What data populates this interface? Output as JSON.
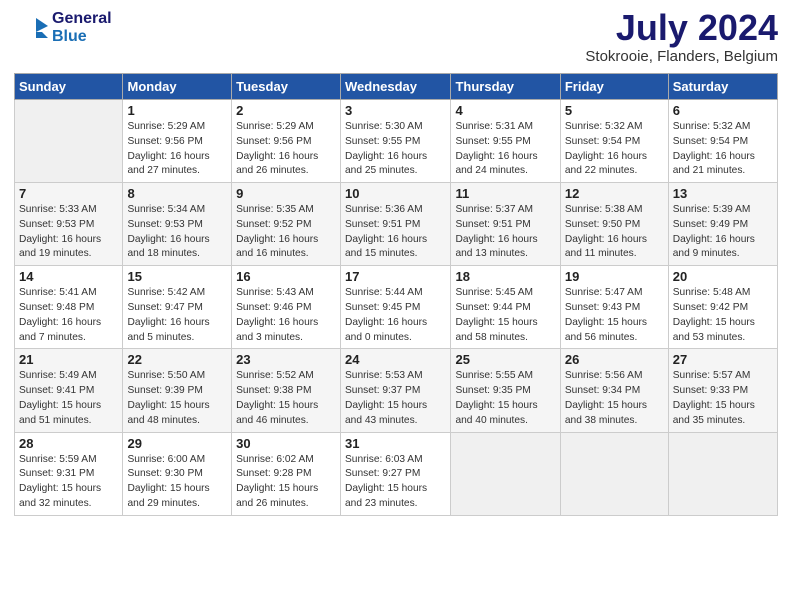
{
  "header": {
    "logo_line1": "General",
    "logo_line2": "Blue",
    "month_title": "July 2024",
    "location": "Stokrooie, Flanders, Belgium"
  },
  "weekdays": [
    "Sunday",
    "Monday",
    "Tuesday",
    "Wednesday",
    "Thursday",
    "Friday",
    "Saturday"
  ],
  "weeks": [
    [
      {
        "day": "",
        "info": ""
      },
      {
        "day": "1",
        "info": "Sunrise: 5:29 AM\nSunset: 9:56 PM\nDaylight: 16 hours\nand 27 minutes."
      },
      {
        "day": "2",
        "info": "Sunrise: 5:29 AM\nSunset: 9:56 PM\nDaylight: 16 hours\nand 26 minutes."
      },
      {
        "day": "3",
        "info": "Sunrise: 5:30 AM\nSunset: 9:55 PM\nDaylight: 16 hours\nand 25 minutes."
      },
      {
        "day": "4",
        "info": "Sunrise: 5:31 AM\nSunset: 9:55 PM\nDaylight: 16 hours\nand 24 minutes."
      },
      {
        "day": "5",
        "info": "Sunrise: 5:32 AM\nSunset: 9:54 PM\nDaylight: 16 hours\nand 22 minutes."
      },
      {
        "day": "6",
        "info": "Sunrise: 5:32 AM\nSunset: 9:54 PM\nDaylight: 16 hours\nand 21 minutes."
      }
    ],
    [
      {
        "day": "7",
        "info": "Sunrise: 5:33 AM\nSunset: 9:53 PM\nDaylight: 16 hours\nand 19 minutes."
      },
      {
        "day": "8",
        "info": "Sunrise: 5:34 AM\nSunset: 9:53 PM\nDaylight: 16 hours\nand 18 minutes."
      },
      {
        "day": "9",
        "info": "Sunrise: 5:35 AM\nSunset: 9:52 PM\nDaylight: 16 hours\nand 16 minutes."
      },
      {
        "day": "10",
        "info": "Sunrise: 5:36 AM\nSunset: 9:51 PM\nDaylight: 16 hours\nand 15 minutes."
      },
      {
        "day": "11",
        "info": "Sunrise: 5:37 AM\nSunset: 9:51 PM\nDaylight: 16 hours\nand 13 minutes."
      },
      {
        "day": "12",
        "info": "Sunrise: 5:38 AM\nSunset: 9:50 PM\nDaylight: 16 hours\nand 11 minutes."
      },
      {
        "day": "13",
        "info": "Sunrise: 5:39 AM\nSunset: 9:49 PM\nDaylight: 16 hours\nand 9 minutes."
      }
    ],
    [
      {
        "day": "14",
        "info": "Sunrise: 5:41 AM\nSunset: 9:48 PM\nDaylight: 16 hours\nand 7 minutes."
      },
      {
        "day": "15",
        "info": "Sunrise: 5:42 AM\nSunset: 9:47 PM\nDaylight: 16 hours\nand 5 minutes."
      },
      {
        "day": "16",
        "info": "Sunrise: 5:43 AM\nSunset: 9:46 PM\nDaylight: 16 hours\nand 3 minutes."
      },
      {
        "day": "17",
        "info": "Sunrise: 5:44 AM\nSunset: 9:45 PM\nDaylight: 16 hours\nand 0 minutes."
      },
      {
        "day": "18",
        "info": "Sunrise: 5:45 AM\nSunset: 9:44 PM\nDaylight: 15 hours\nand 58 minutes."
      },
      {
        "day": "19",
        "info": "Sunrise: 5:47 AM\nSunset: 9:43 PM\nDaylight: 15 hours\nand 56 minutes."
      },
      {
        "day": "20",
        "info": "Sunrise: 5:48 AM\nSunset: 9:42 PM\nDaylight: 15 hours\nand 53 minutes."
      }
    ],
    [
      {
        "day": "21",
        "info": "Sunrise: 5:49 AM\nSunset: 9:41 PM\nDaylight: 15 hours\nand 51 minutes."
      },
      {
        "day": "22",
        "info": "Sunrise: 5:50 AM\nSunset: 9:39 PM\nDaylight: 15 hours\nand 48 minutes."
      },
      {
        "day": "23",
        "info": "Sunrise: 5:52 AM\nSunset: 9:38 PM\nDaylight: 15 hours\nand 46 minutes."
      },
      {
        "day": "24",
        "info": "Sunrise: 5:53 AM\nSunset: 9:37 PM\nDaylight: 15 hours\nand 43 minutes."
      },
      {
        "day": "25",
        "info": "Sunrise: 5:55 AM\nSunset: 9:35 PM\nDaylight: 15 hours\nand 40 minutes."
      },
      {
        "day": "26",
        "info": "Sunrise: 5:56 AM\nSunset: 9:34 PM\nDaylight: 15 hours\nand 38 minutes."
      },
      {
        "day": "27",
        "info": "Sunrise: 5:57 AM\nSunset: 9:33 PM\nDaylight: 15 hours\nand 35 minutes."
      }
    ],
    [
      {
        "day": "28",
        "info": "Sunrise: 5:59 AM\nSunset: 9:31 PM\nDaylight: 15 hours\nand 32 minutes."
      },
      {
        "day": "29",
        "info": "Sunrise: 6:00 AM\nSunset: 9:30 PM\nDaylight: 15 hours\nand 29 minutes."
      },
      {
        "day": "30",
        "info": "Sunrise: 6:02 AM\nSunset: 9:28 PM\nDaylight: 15 hours\nand 26 minutes."
      },
      {
        "day": "31",
        "info": "Sunrise: 6:03 AM\nSunset: 9:27 PM\nDaylight: 15 hours\nand 23 minutes."
      },
      {
        "day": "",
        "info": ""
      },
      {
        "day": "",
        "info": ""
      },
      {
        "day": "",
        "info": ""
      }
    ]
  ]
}
